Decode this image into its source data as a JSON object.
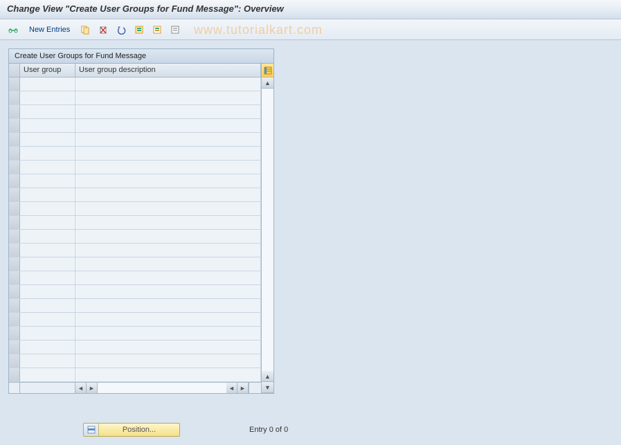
{
  "title": "Change View \"Create User Groups for Fund Message\": Overview",
  "toolbar": {
    "new_entries": "New Entries"
  },
  "watermark": "www.tutorialkart.com",
  "panel": {
    "title": "Create User Groups for Fund Message",
    "columns": {
      "user_group": "User group",
      "user_group_desc": "User group description"
    }
  },
  "footer": {
    "position_label": "Position...",
    "entry_status": "Entry 0 of 0"
  }
}
